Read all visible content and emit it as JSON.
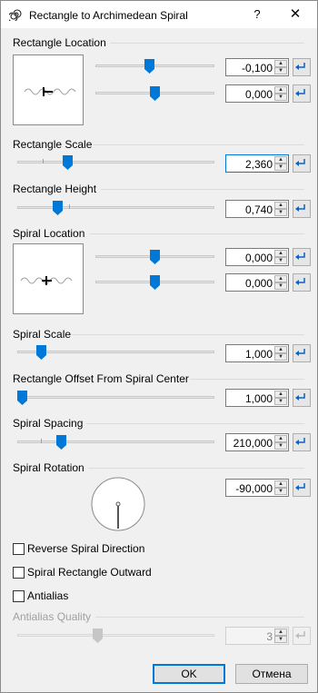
{
  "window": {
    "title": "Rectangle to Archimedean Spiral",
    "help": "?",
    "close": "✕"
  },
  "sections": {
    "rect_location": "Rectangle Location",
    "rect_scale": "Rectangle Scale",
    "rect_height": "Rectangle Height",
    "spiral_location": "Spiral Location",
    "spiral_scale": "Spiral Scale",
    "rect_offset": "Rectangle Offset From Spiral Center",
    "spiral_spacing": "Spiral Spacing",
    "spiral_rotation": "Spiral Rotation",
    "antialias_quality": "Antialias Quality"
  },
  "values": {
    "rect_location_x": "-0,100",
    "rect_location_y": "0,000",
    "rect_scale": "2,360",
    "rect_height": "0,740",
    "spiral_location_x": "0,000",
    "spiral_location_y": "0,000",
    "spiral_scale": "1,000",
    "rect_offset": "1,000",
    "spiral_spacing": "210,000",
    "spiral_rotation": "-90,000",
    "antialias_quality": "3"
  },
  "checkboxes": {
    "reverse": "Reverse Spiral Direction",
    "outward": "Spiral Rectangle Outward",
    "antialias": "Antialias"
  },
  "buttons": {
    "ok": "OK",
    "cancel": "Отмена"
  },
  "colors": {
    "accent": "#0078d7",
    "thumb_disabled": "#c6c6c6"
  },
  "icons": {
    "spin_up": "▲",
    "spin_down": "▼",
    "reset": "reset-arrow-icon"
  }
}
